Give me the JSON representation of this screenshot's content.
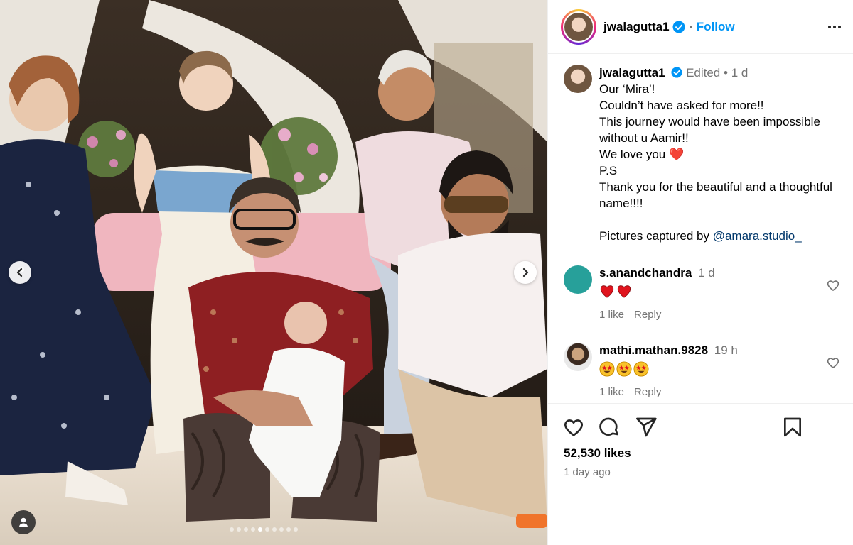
{
  "post": {
    "username": "jwalagutta1",
    "follow_label": "Follow",
    "caption": {
      "edited_label": "Edited",
      "time": "1 d",
      "text": "Our ‘Mira’!\nCouldn’t have asked for more!!\nThis journey would have been impossible without u Aamir!!\nWe love you ❤️\nP.S\nThank you for the beautiful and a thoughtful name!!!!",
      "credit_prefix": "Pictures captured by ",
      "credit_mention": "@amara.studio_"
    },
    "comments": [
      {
        "username": "s.anandchandra",
        "time": "1 d",
        "emoji": "❤️❤️",
        "likes": "1 like",
        "reply_label": "Reply"
      },
      {
        "username": "mathi.mathan.9828",
        "time": "19 h",
        "emoji": "🤩🤩🤩",
        "likes": "1 like",
        "reply_label": "Reply"
      }
    ],
    "likes_count": "52,530 likes",
    "posted_ago": "1 day ago"
  },
  "carousel": {
    "total": 10,
    "active_index": 4
  },
  "colors": {
    "accent": "#0095f6",
    "heart": "#ed4956",
    "muted": "#737373",
    "mention": "#00376b"
  },
  "icons": [
    "chevron-left-icon",
    "chevron-right-icon",
    "user-tag-icon",
    "verified-badge-icon",
    "more-options-icon",
    "heart-icon",
    "comment-icon",
    "share-icon",
    "save-icon"
  ]
}
